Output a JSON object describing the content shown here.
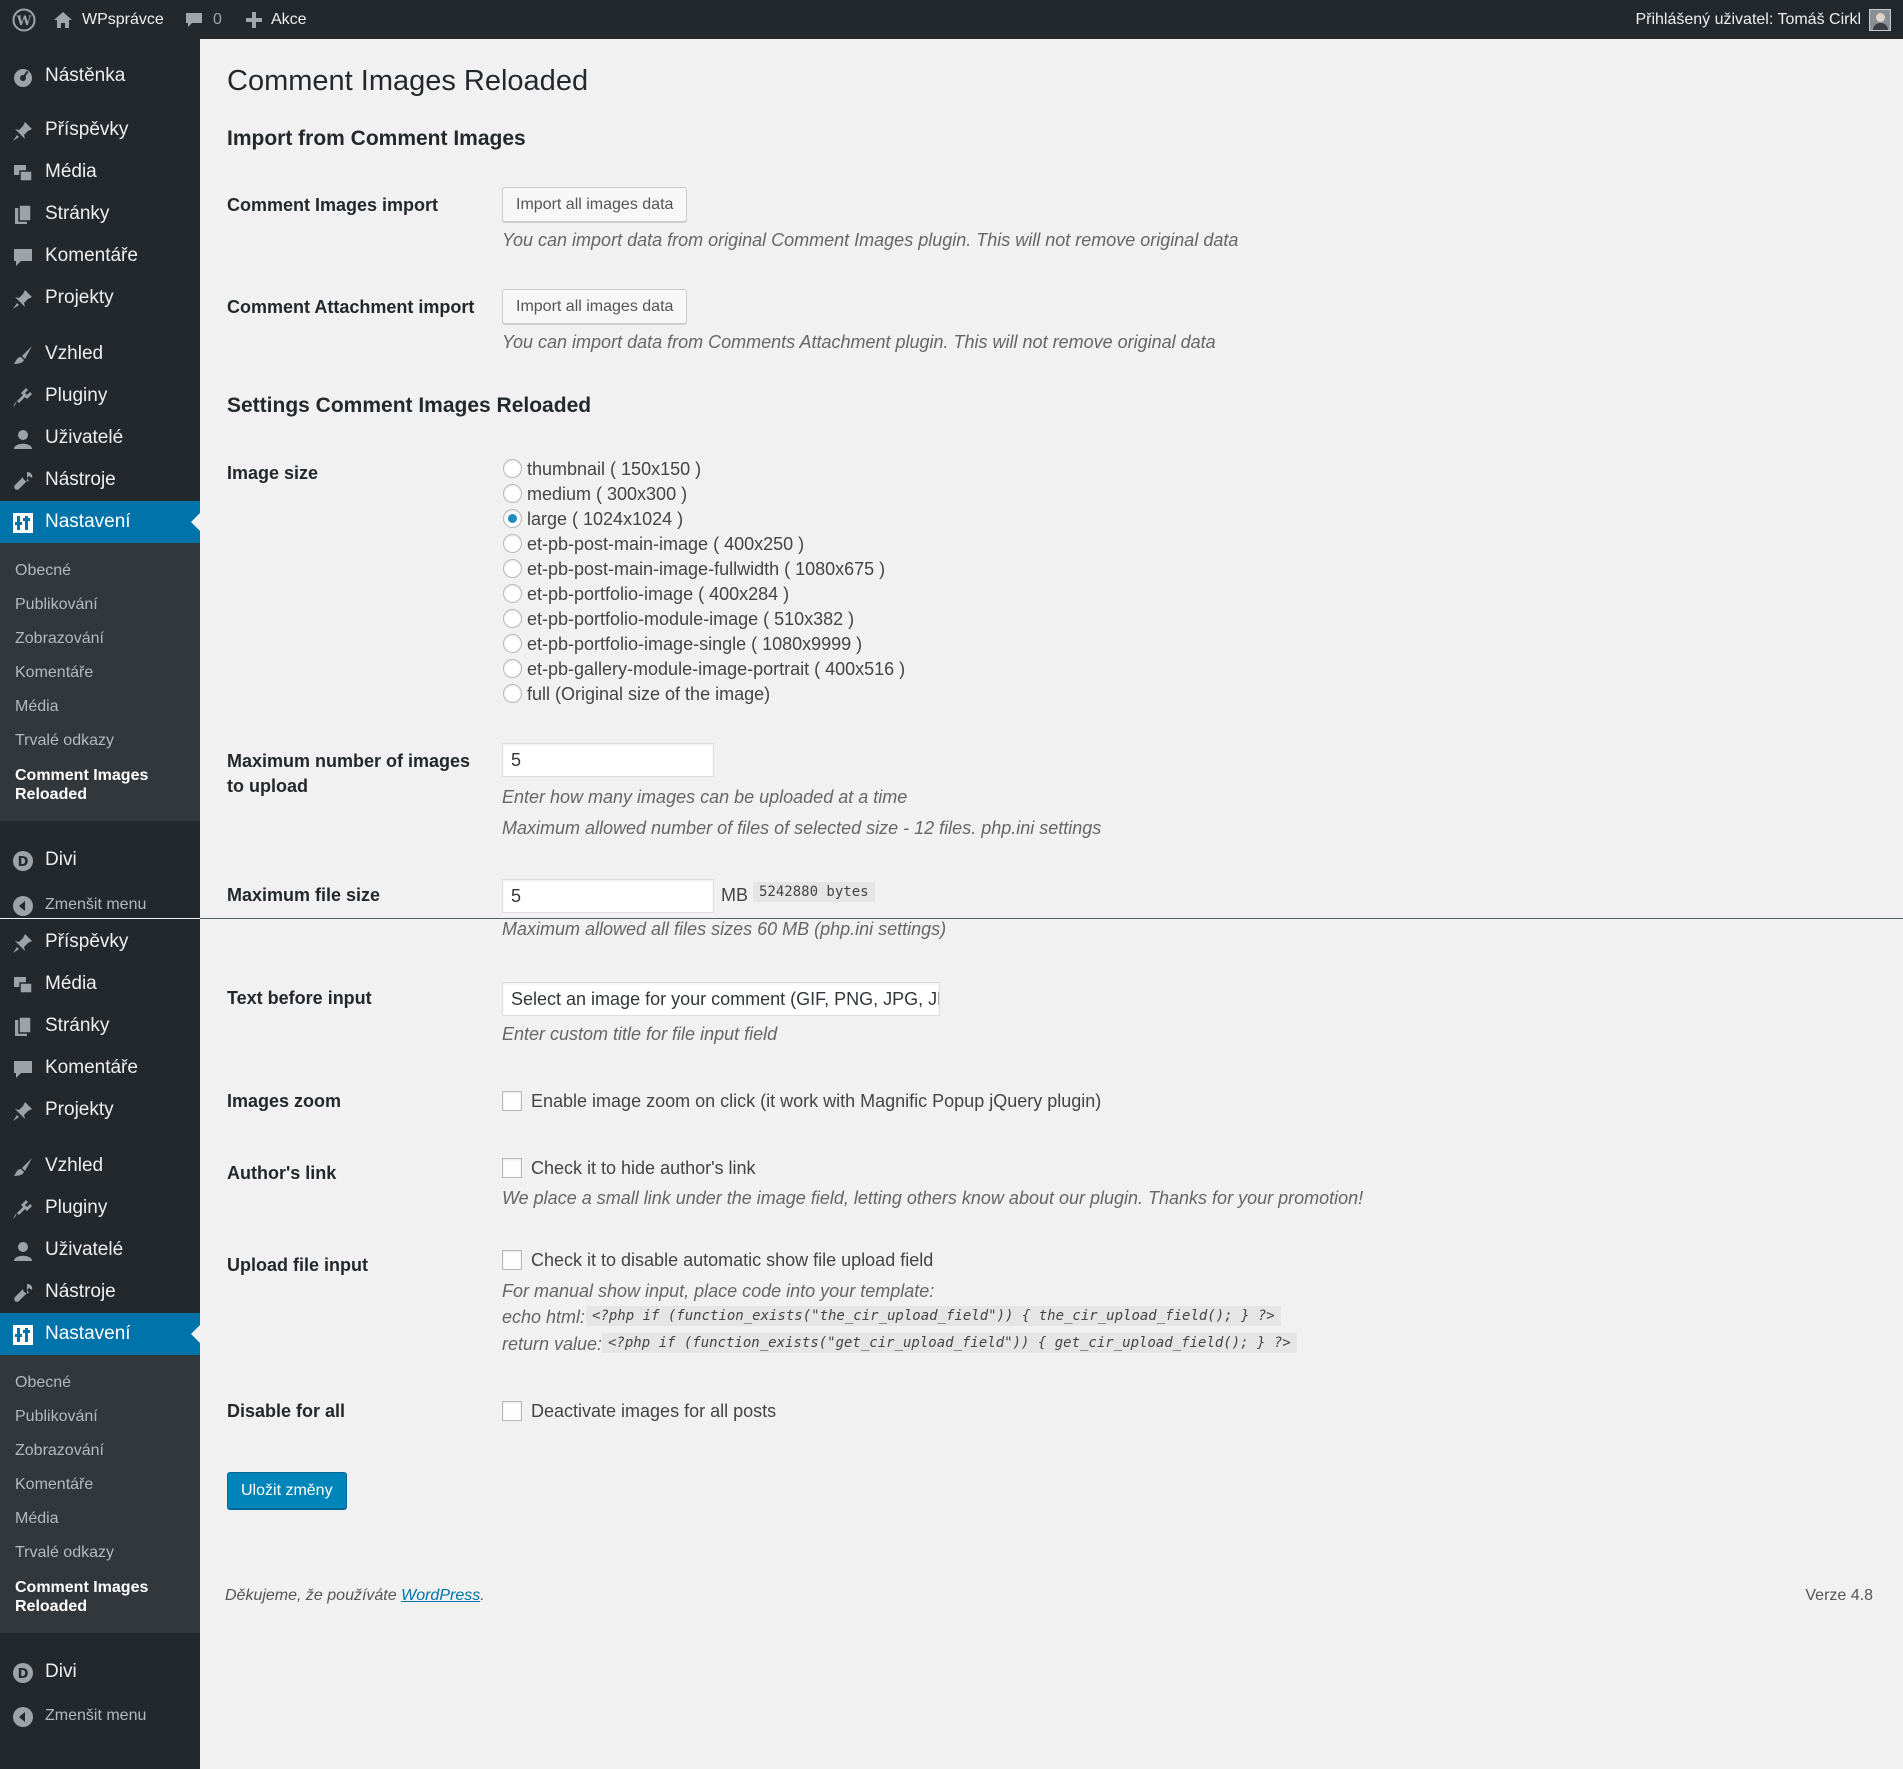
{
  "admin_bar": {
    "site_name": "WPsprávce",
    "comments_count": "0",
    "new_label": "Akce",
    "user_greeting": "Přihlášený uživatel: Tomáš Cirkl"
  },
  "sidebar": {
    "items": [
      "Nástěnka",
      "Příspěvky",
      "Média",
      "Stránky",
      "Komentáře",
      "Projekty",
      "Vzhled",
      "Pluginy",
      "Uživatelé",
      "Nástroje",
      "Nastavení"
    ],
    "submenu": [
      "Obecné",
      "Publikování",
      "Zobrazování",
      "Komentáře",
      "Média",
      "Trvalé odkazy",
      "Comment Images Reloaded"
    ],
    "divi": "Divi",
    "collapse": "Zmenšit menu"
  },
  "page": {
    "title": "Comment Images Reloaded",
    "import_heading": "Import from Comment Images",
    "ci_import_label": "Comment Images import",
    "ci_import_button": "Import all images data",
    "ci_import_desc": "You can import data from original Comment Images plugin. This will not remove original data",
    "ca_import_label": "Comment Attachment import",
    "ca_import_button": "Import all images data",
    "ca_import_desc": "You can import data from Comments Attachment plugin. This will not remove original data",
    "settings_heading": "Settings Comment Images Reloaded",
    "image_size_label": "Image size",
    "image_sizes": [
      "thumbnail ( 150x150 )",
      "medium ( 300x300 )",
      "large ( 1024x1024 )",
      "et-pb-post-main-image ( 400x250 )",
      "et-pb-post-main-image-fullwidth ( 1080x675 )",
      "et-pb-portfolio-image ( 400x284 )",
      "et-pb-portfolio-module-image ( 510x382 )",
      "et-pb-portfolio-image-single ( 1080x9999 )",
      "et-pb-gallery-module-image-portrait ( 400x516 )",
      "full (Original size of the image)"
    ],
    "image_size_selected": "large ( 1024x1024 )",
    "max_images_label": "Maximum number of images to upload",
    "max_images_value": "5",
    "max_images_desc1": "Enter how many images can be uploaded at a time",
    "max_images_desc2": "Maximum allowed number of files of selected size - 12 files. php.ini settings",
    "max_file_label": "Maximum file size",
    "max_file_value": "5",
    "max_file_unit": "MB",
    "max_file_bytes": "5242880 bytes",
    "max_file_desc": "Maximum allowed all files sizes 60 MB (php.ini settings)",
    "text_before_label": "Text before input",
    "text_before_value": "Select an image for your comment (GIF, PNG, JPG, JPEG):",
    "text_before_desc": "Enter custom title for file input field",
    "zoom_label": "Images zoom",
    "zoom_check": "Enable image zoom on click (it work with Magnific Popup jQuery plugin)",
    "author_label": "Author's link",
    "author_check": "Check it to hide author's link",
    "author_desc": "We place a small link under the image field, letting others know about our plugin. Thanks for your promotion!",
    "upload_label": "Upload file input",
    "upload_check": "Check it to disable automatic show file upload field",
    "upload_desc": "For manual show input, place code into your template:",
    "echo_label": "echo html:",
    "echo_code": "<?php if (function_exists(\"the_cir_upload_field\")) { the_cir_upload_field(); } ?>",
    "return_label": "return value:",
    "return_code": "<?php if (function_exists(\"get_cir_upload_field\")) { get_cir_upload_field(); } ?>",
    "disable_label": "Disable for all",
    "disable_check": "Deactivate images for all posts",
    "save_button": "Uložit změny"
  },
  "footer": {
    "thanks_prefix": "Děkujeme, že používáte ",
    "wp_link": "WordPress",
    "thanks_suffix": ".",
    "version": "Verze 4.8"
  },
  "colors": {
    "admin_bar_bg": "#23282d",
    "menu_active": "#0073aa",
    "primary_button": "#0085ba",
    "page_bg": "#f1f1f1"
  }
}
